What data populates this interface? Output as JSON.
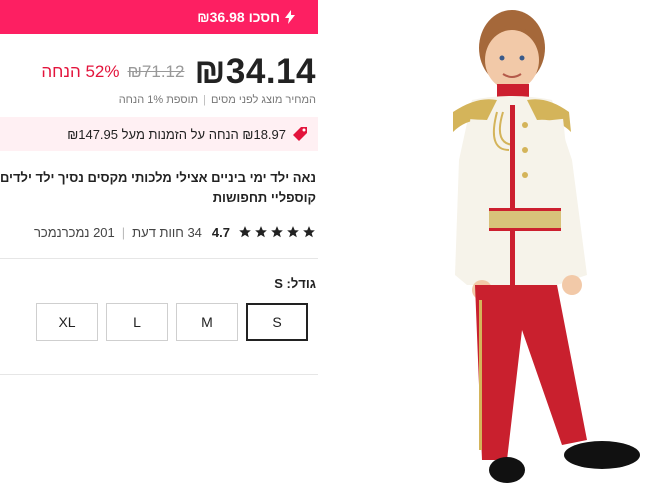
{
  "deal": {
    "text": "חסכו ₪36.98",
    "icon": "lightning-icon"
  },
  "price": {
    "current": "₪34.14",
    "original": "₪71.12",
    "discount": "52% הנחה",
    "note_before_tax": "המחיר מוצג לפני מסים",
    "note_extra": "תוספת 1% הנחה"
  },
  "promo": {
    "text": "₪18.97 הנחה על הזמנות מעל ₪147.95",
    "icon": "price-tag-icon"
  },
  "product": {
    "title_line1": "נאה ילד ימי ביניים אצילי מלכותי מקסים נסיך ילד ילדים",
    "title_line2": "קוספליי תחפושות"
  },
  "rating": {
    "value": "4.7",
    "stars": 5,
    "reviews": "34 חוות דעת",
    "sold": "201 נמכרנמכר"
  },
  "size": {
    "label": "גודל: S",
    "options": [
      "S",
      "M",
      "L",
      "XL"
    ],
    "selected": "S"
  },
  "colors": {
    "accent": "#fd1f62",
    "discount": "#e3143c",
    "promo_bg": "#fff0f3"
  }
}
